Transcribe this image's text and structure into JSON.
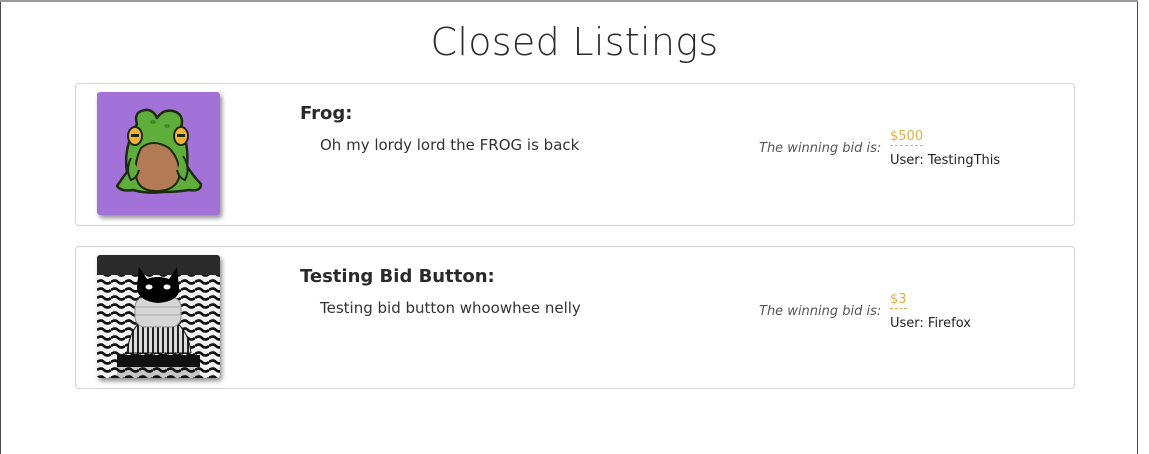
{
  "page": {
    "title": "Closed Listings"
  },
  "listings": [
    {
      "title": "Frog:",
      "description": "Oh my lordy lord the FROG is back",
      "bid_label": "The winning bid is:",
      "bid_amount": "$500",
      "bid_user": "User: TestingThis",
      "image": "frog-image"
    },
    {
      "title": "Testing Bid Button:",
      "description": "Testing bid button whoowhee nelly",
      "bid_label": "The winning bid is:",
      "bid_amount": "$3",
      "bid_user": "User: Firefox",
      "image": "cat-image"
    }
  ],
  "colors": {
    "bid_amount": "#e0b04a",
    "frog_bg": "#a272d8",
    "frog_green": "#5fae3b",
    "border": "#d4d4d4"
  }
}
